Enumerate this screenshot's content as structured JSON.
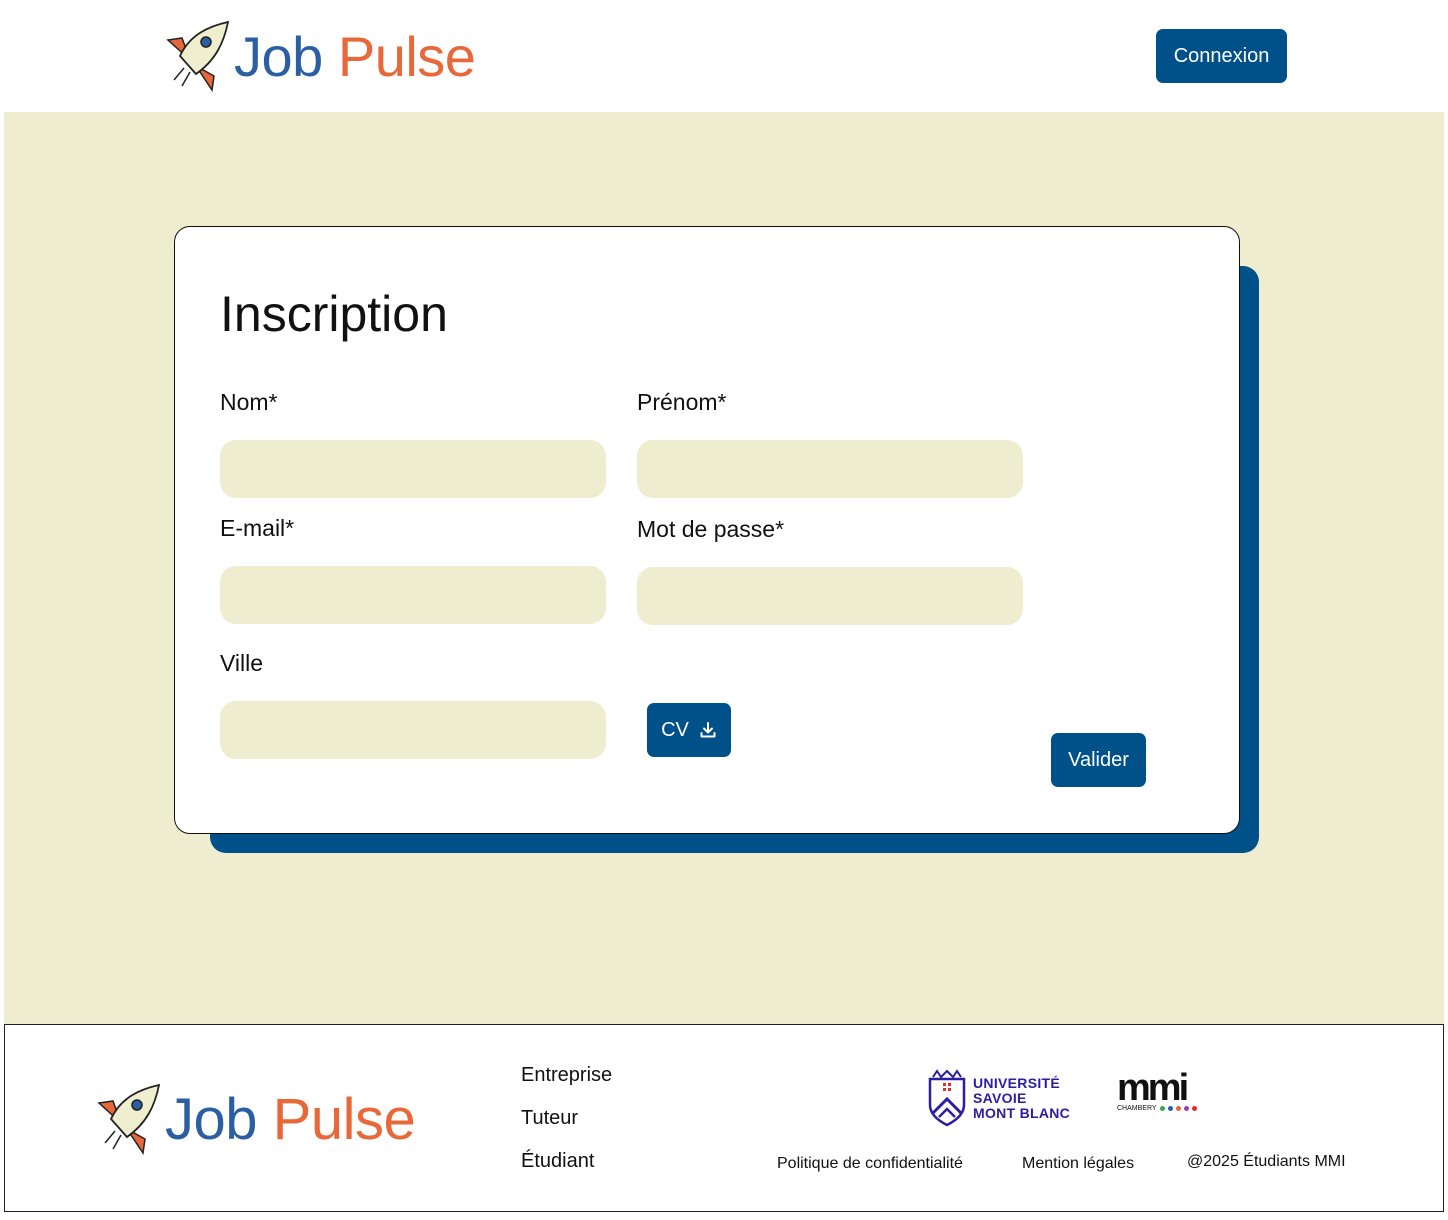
{
  "header": {
    "logo": {
      "word1": "Job",
      "word2": "Pulse"
    },
    "login_label": "Connexion"
  },
  "form": {
    "title": "Inscription",
    "fields": {
      "nom": {
        "label": "Nom*",
        "value": ""
      },
      "prenom": {
        "label": "Prénom*",
        "value": ""
      },
      "email": {
        "label": "E-mail*",
        "value": ""
      },
      "password": {
        "label": "Mot de passe*",
        "value": ""
      },
      "ville": {
        "label": "Ville",
        "value": ""
      }
    },
    "cv_label": "CV",
    "submit_label": "Valider"
  },
  "footer": {
    "logo": {
      "word1": "Job",
      "word2": "Pulse"
    },
    "nav": [
      "Entreprise",
      "Tuteur",
      "Étudiant"
    ],
    "partner1": {
      "line1": "UNIVERSITÉ",
      "line2": "SAVOIE",
      "line3": "MONT BLANC"
    },
    "partner2": {
      "name": "mmi",
      "sub": "CHAMBERY"
    },
    "links": {
      "privacy": "Politique de confidentialité",
      "legal": "Mention légales",
      "copyright": "@2025 Étudiants MMI"
    }
  },
  "colors": {
    "primary": "#00508a",
    "background": "#eeedd0",
    "logo_blue": "#2a5fa4",
    "logo_orange": "#e8683a"
  },
  "icons": [
    "rocket-icon",
    "download-icon"
  ]
}
